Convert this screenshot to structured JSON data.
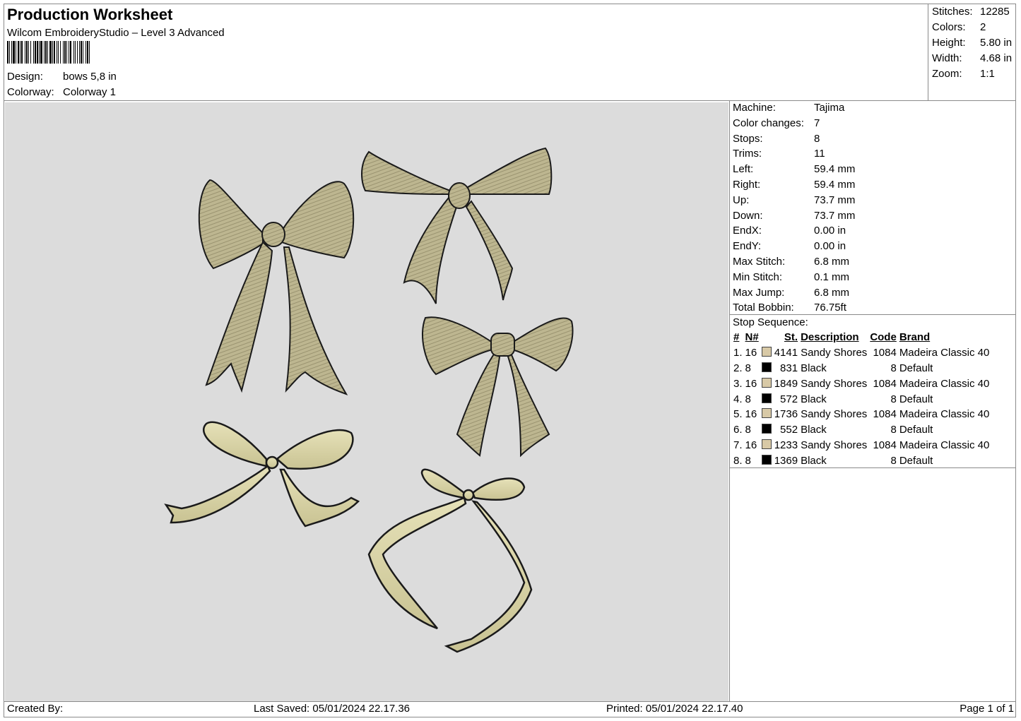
{
  "header": {
    "title": "Production Worksheet",
    "software": "Wilcom EmbroideryStudio – Level 3 Advanced",
    "design_label": "Design:",
    "design_value": "bows 5,8 in",
    "colorway_label": "Colorway:",
    "colorway_value": "Colorway 1"
  },
  "summary": [
    {
      "label": "Stitches:",
      "value": "12285"
    },
    {
      "label": "Colors:",
      "value": "2"
    },
    {
      "label": "Height:",
      "value": "5.80 in"
    },
    {
      "label": "Width:",
      "value": "4.68 in"
    },
    {
      "label": "Zoom:",
      "value": "1:1"
    }
  ],
  "machine_info": [
    {
      "label": "Machine:",
      "value": "Tajima"
    },
    {
      "label": "Color changes:",
      "value": "7"
    },
    {
      "label": "Stops:",
      "value": "8"
    },
    {
      "label": "Trims:",
      "value": "11"
    },
    {
      "label": "Left:",
      "value": "59.4 mm"
    },
    {
      "label": "Right:",
      "value": "59.4 mm"
    },
    {
      "label": "Up:",
      "value": "73.7 mm"
    },
    {
      "label": "Down:",
      "value": "73.7 mm"
    },
    {
      "label": "EndX:",
      "value": "0.00 in"
    },
    {
      "label": "EndY:",
      "value": "0.00 in"
    },
    {
      "label": "Max Stitch:",
      "value": "6.8 mm"
    },
    {
      "label": "Min Stitch:",
      "value": "0.1 mm"
    },
    {
      "label": "Max Jump:",
      "value": "6.8 mm"
    },
    {
      "label": "Total Bobbin:",
      "value": "76.75ft"
    }
  ],
  "stop_sequence": {
    "title": "Stop Sequence:",
    "columns": [
      "#",
      "N#",
      "St.",
      "Description",
      "Code",
      "Brand"
    ],
    "rows": [
      {
        "idx": "1.",
        "n": "16",
        "color": "#d8c9a6",
        "st": "4141",
        "desc": "Sandy Shores",
        "code": "1084",
        "brand": "Madeira Classic 40"
      },
      {
        "idx": "2.",
        "n": "8",
        "color": "#000000",
        "st": "831",
        "desc": "Black",
        "code": "8",
        "brand": "Default"
      },
      {
        "idx": "3.",
        "n": "16",
        "color": "#d8c9a6",
        "st": "1849",
        "desc": "Sandy Shores",
        "code": "1084",
        "brand": "Madeira Classic 40"
      },
      {
        "idx": "4.",
        "n": "8",
        "color": "#000000",
        "st": "572",
        "desc": "Black",
        "code": "8",
        "brand": "Default"
      },
      {
        "idx": "5.",
        "n": "16",
        "color": "#d8c9a6",
        "st": "1736",
        "desc": "Sandy Shores",
        "code": "1084",
        "brand": "Madeira Classic 40"
      },
      {
        "idx": "6.",
        "n": "8",
        "color": "#000000",
        "st": "552",
        "desc": "Black",
        "code": "8",
        "brand": "Default"
      },
      {
        "idx": "7.",
        "n": "16",
        "color": "#d8c9a6",
        "st": "1233",
        "desc": "Sandy Shores",
        "code": "1084",
        "brand": "Madeira Classic 40"
      },
      {
        "idx": "8.",
        "n": "8",
        "color": "#000000",
        "st": "1369",
        "desc": "Black",
        "code": "8",
        "brand": "Default"
      }
    ]
  },
  "footer": {
    "created_by": "Created By:",
    "last_saved": "Last Saved: 05/01/2024 22.17.36",
    "printed": "Printed: 05/01/2024 22.17.40",
    "page": "Page 1 of 1"
  },
  "colors": {
    "canvas_bg": "#dcdcdc",
    "thread_fill": "#b7b08a",
    "thread_light": "#d8d3a8",
    "outline": "#1a1a1a"
  }
}
